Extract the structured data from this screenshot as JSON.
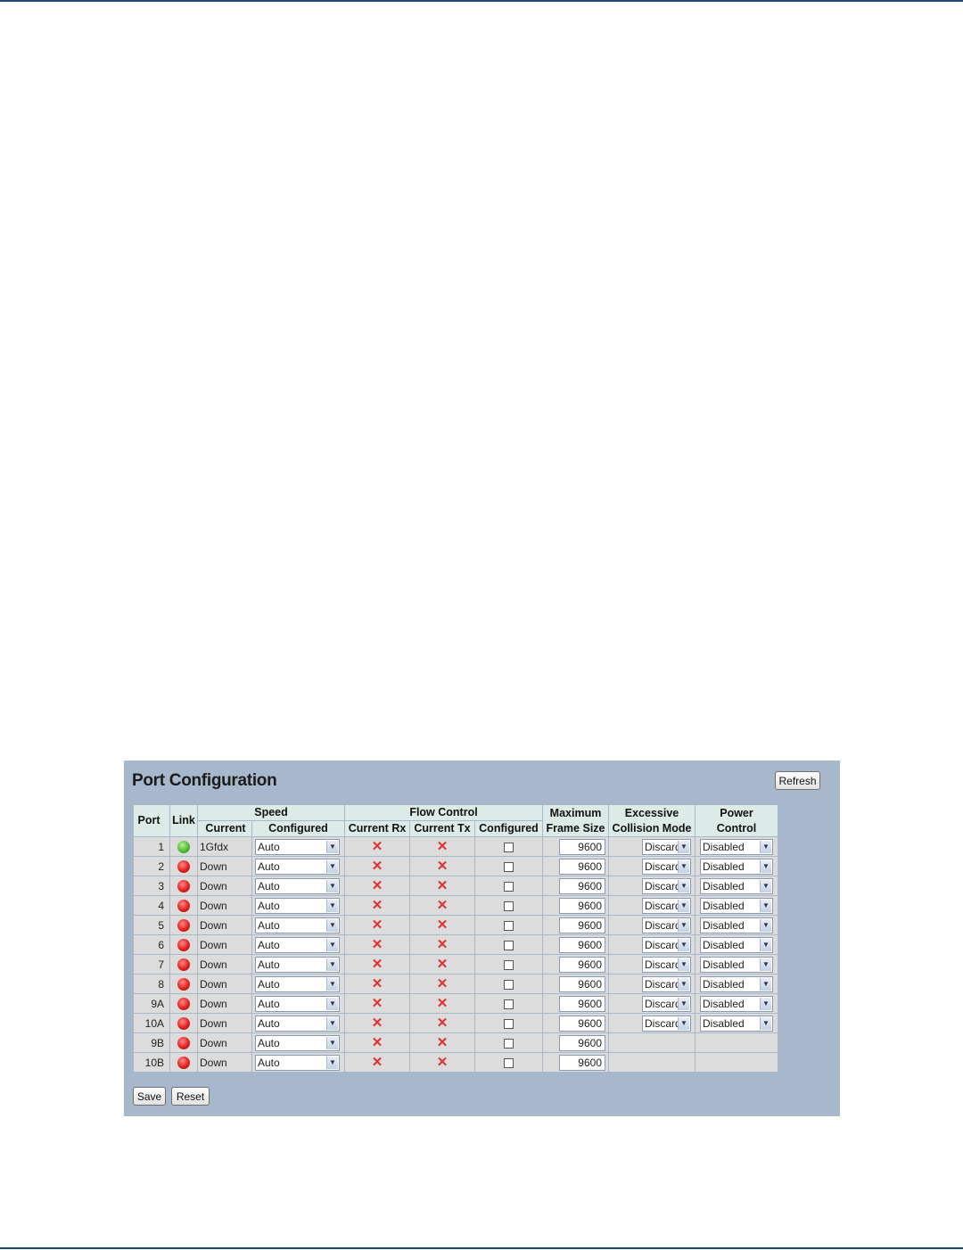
{
  "panel": {
    "title": "Port Configuration",
    "refresh_label": "Refresh",
    "save_label": "Save",
    "reset_label": "Reset"
  },
  "headers": {
    "port": "Port",
    "link": "Link",
    "speed": "Speed",
    "speed_current": "Current",
    "speed_configured": "Configured",
    "flow_control": "Flow Control",
    "fc_current_rx": "Current Rx",
    "fc_current_tx": "Current Tx",
    "fc_configured": "Configured",
    "max_frame_line1": "Maximum",
    "max_frame_line2": "Frame Size",
    "excessive_line1": "Excessive",
    "excessive_line2": "Collision Mode",
    "power_line1": "Power",
    "power_line2": "Control"
  },
  "icons": {
    "link_up_color": "#4cbc35",
    "link_down_color": "#e41f1f",
    "flow_x": "✕"
  },
  "rows": [
    {
      "port": "1",
      "link": "up",
      "current": "1Gfdx",
      "speed": "Auto",
      "fc_configured": false,
      "max_frame": "9600",
      "excessive": "Discard",
      "power": "Disabled"
    },
    {
      "port": "2",
      "link": "down",
      "current": "Down",
      "speed": "Auto",
      "fc_configured": false,
      "max_frame": "9600",
      "excessive": "Discard",
      "power": "Disabled"
    },
    {
      "port": "3",
      "link": "down",
      "current": "Down",
      "speed": "Auto",
      "fc_configured": false,
      "max_frame": "9600",
      "excessive": "Discard",
      "power": "Disabled"
    },
    {
      "port": "4",
      "link": "down",
      "current": "Down",
      "speed": "Auto",
      "fc_configured": false,
      "max_frame": "9600",
      "excessive": "Discard",
      "power": "Disabled"
    },
    {
      "port": "5",
      "link": "down",
      "current": "Down",
      "speed": "Auto",
      "fc_configured": false,
      "max_frame": "9600",
      "excessive": "Discard",
      "power": "Disabled"
    },
    {
      "port": "6",
      "link": "down",
      "current": "Down",
      "speed": "Auto",
      "fc_configured": false,
      "max_frame": "9600",
      "excessive": "Discard",
      "power": "Disabled"
    },
    {
      "port": "7",
      "link": "down",
      "current": "Down",
      "speed": "Auto",
      "fc_configured": false,
      "max_frame": "9600",
      "excessive": "Discard",
      "power": "Disabled"
    },
    {
      "port": "8",
      "link": "down",
      "current": "Down",
      "speed": "Auto",
      "fc_configured": false,
      "max_frame": "9600",
      "excessive": "Discard",
      "power": "Disabled"
    },
    {
      "port": "9A",
      "link": "down",
      "current": "Down",
      "speed": "Auto",
      "fc_configured": false,
      "max_frame": "9600",
      "excessive": "Discard",
      "power": "Disabled"
    },
    {
      "port": "10A",
      "link": "down",
      "current": "Down",
      "speed": "Auto",
      "fc_configured": false,
      "max_frame": "9600",
      "excessive": "Discard",
      "power": "Disabled"
    },
    {
      "port": "9B",
      "link": "down",
      "current": "Down",
      "speed": "Auto",
      "fc_configured": false,
      "max_frame": "9600",
      "excessive": "",
      "power": ""
    },
    {
      "port": "10B",
      "link": "down",
      "current": "Down",
      "speed": "Auto",
      "fc_configured": false,
      "max_frame": "9600",
      "excessive": "",
      "power": ""
    }
  ]
}
